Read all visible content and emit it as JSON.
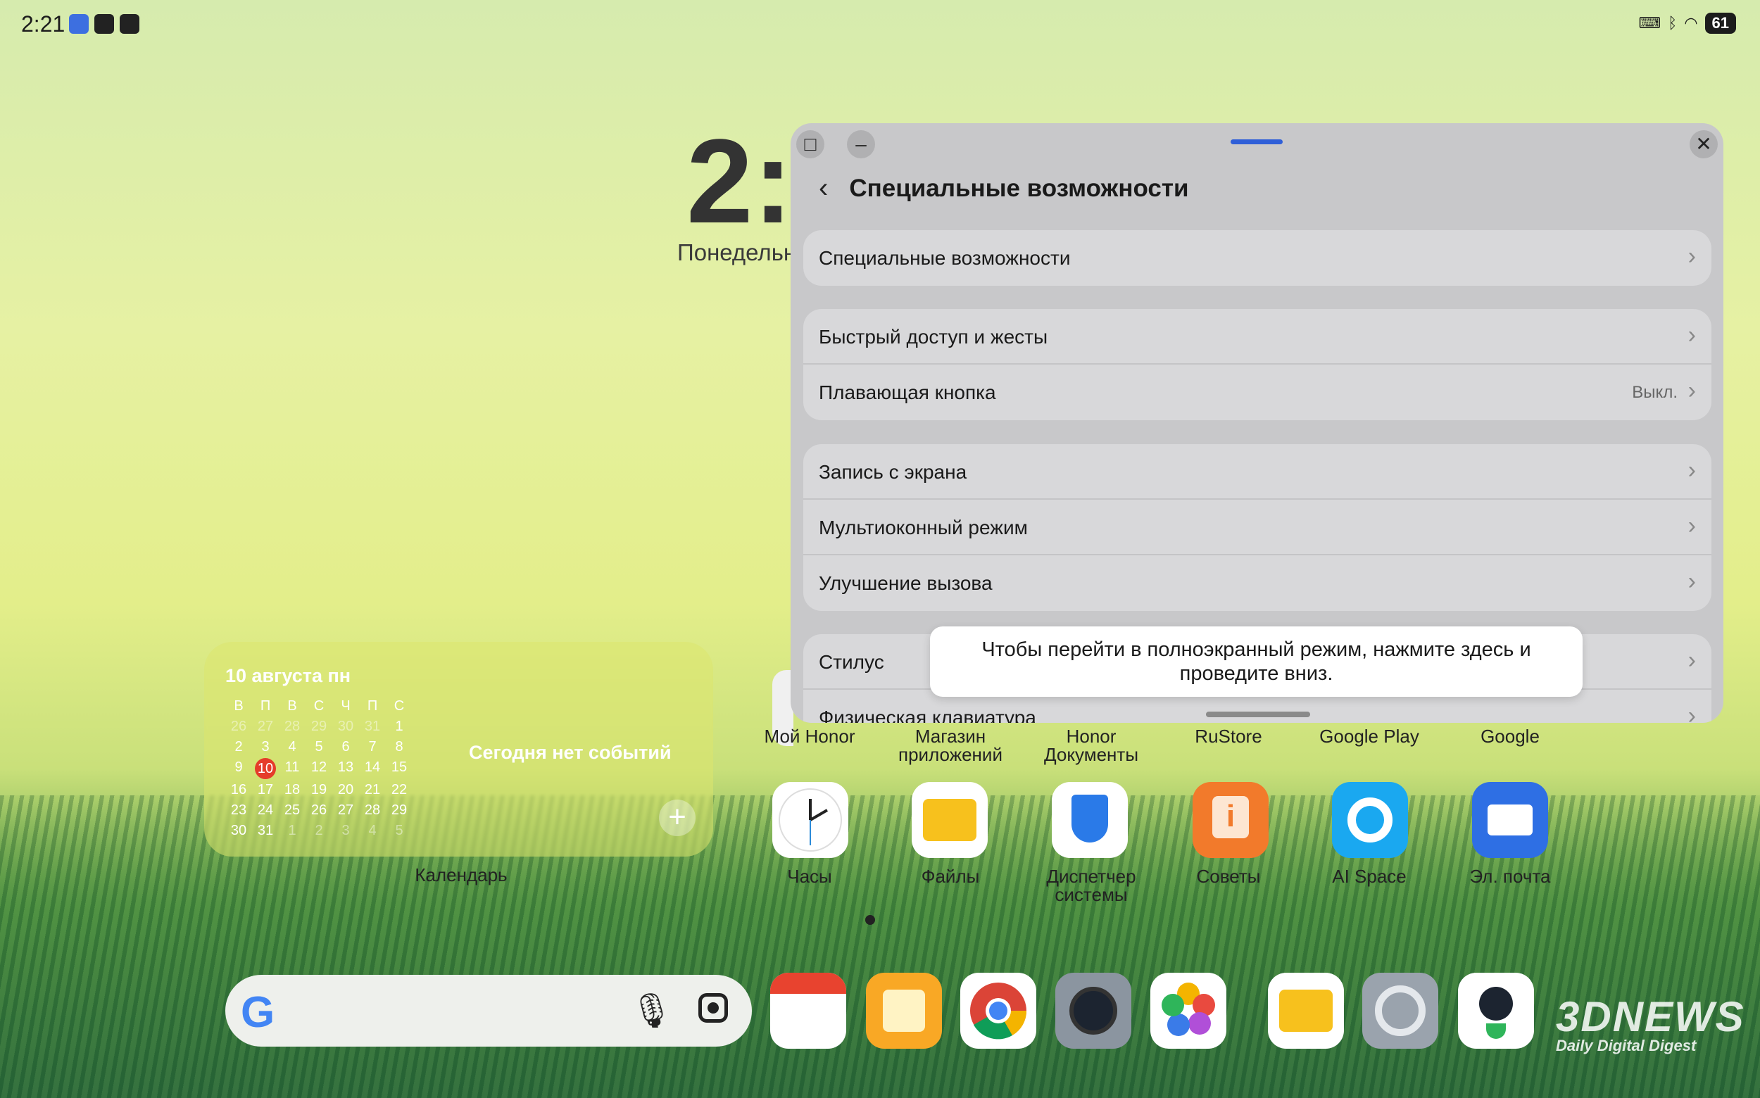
{
  "status_bar": {
    "time": "2:21",
    "battery": "61",
    "left_icons": [
      "shield-app-icon",
      "gallery-app-icon",
      "file-app-icon"
    ],
    "right_icons": [
      "keyboard-icon",
      "bluetooth-icon",
      "wifi-icon",
      "battery-icon"
    ]
  },
  "home": {
    "clock_partial": "2:",
    "date_partial": "Понедельн"
  },
  "calendar_widget": {
    "title": "10 августа пн",
    "weekdays": [
      "В",
      "П",
      "В",
      "С",
      "Ч",
      "П",
      "С"
    ],
    "weeks": [
      [
        "26",
        "27",
        "28",
        "29",
        "30",
        "31",
        "1"
      ],
      [
        "2",
        "3",
        "4",
        "5",
        "6",
        "7",
        "8"
      ],
      [
        "9",
        "10",
        "11",
        "12",
        "13",
        "14",
        "15"
      ],
      [
        "16",
        "17",
        "18",
        "19",
        "20",
        "21",
        "22"
      ],
      [
        "23",
        "24",
        "25",
        "26",
        "27",
        "28",
        "29"
      ],
      [
        "30",
        "31",
        "1",
        "2",
        "3",
        "4",
        "5"
      ]
    ],
    "today": "10",
    "no_events": "Сегодня нет событий",
    "add_symbol": "+",
    "label": "Календарь"
  },
  "apps_row1_labels": [
    "Мой Honor",
    "Магазин приложений",
    "Honor Документы",
    "RuStore",
    "Google Play",
    "Google"
  ],
  "apps_row2": [
    {
      "label": "Часы",
      "icon": "clock-icon"
    },
    {
      "label": "Файлы",
      "icon": "folder-icon"
    },
    {
      "label": "Диспетчер системы",
      "icon": "shield-icon"
    },
    {
      "label": "Советы",
      "icon": "tips-icon"
    },
    {
      "label": "AI Space",
      "icon": "ai-space-icon"
    },
    {
      "label": "Эл. почта",
      "icon": "mail-icon"
    }
  ],
  "dock": {
    "search_g": "G",
    "mic_glyph": "🎙",
    "apps": [
      "calendar-icon",
      "notes-icon",
      "chrome-icon",
      "camera-icon",
      "gallery-icon",
      "files-icon",
      "settings-icon",
      "ninja-icon"
    ]
  },
  "window": {
    "title": "Специальные возможности",
    "back_glyph": "‹",
    "controls": {
      "restore": "□",
      "minimize": "–",
      "close": "✕"
    },
    "groups": [
      [
        {
          "label": "Специальные возможности",
          "value": ""
        }
      ],
      [
        {
          "label": "Быстрый доступ и жесты",
          "value": ""
        },
        {
          "label": "Плавающая кнопка",
          "value": "Выкл."
        }
      ],
      [
        {
          "label": "Запись с экрана",
          "value": ""
        },
        {
          "label": "Мультиоконный режим",
          "value": ""
        },
        {
          "label": "Улучшение вызова",
          "value": ""
        }
      ],
      [
        {
          "label": "Стилус",
          "value": ""
        },
        {
          "label": "Физическая клавиатура",
          "value": ""
        }
      ]
    ],
    "chevron": "›"
  },
  "tooltip": {
    "text": "Чтобы перейти в полноэкранный режим, нажмите здесь и проведите вниз."
  },
  "watermark": {
    "main": "3DNEWS",
    "sub": "Daily Digital Digest"
  }
}
